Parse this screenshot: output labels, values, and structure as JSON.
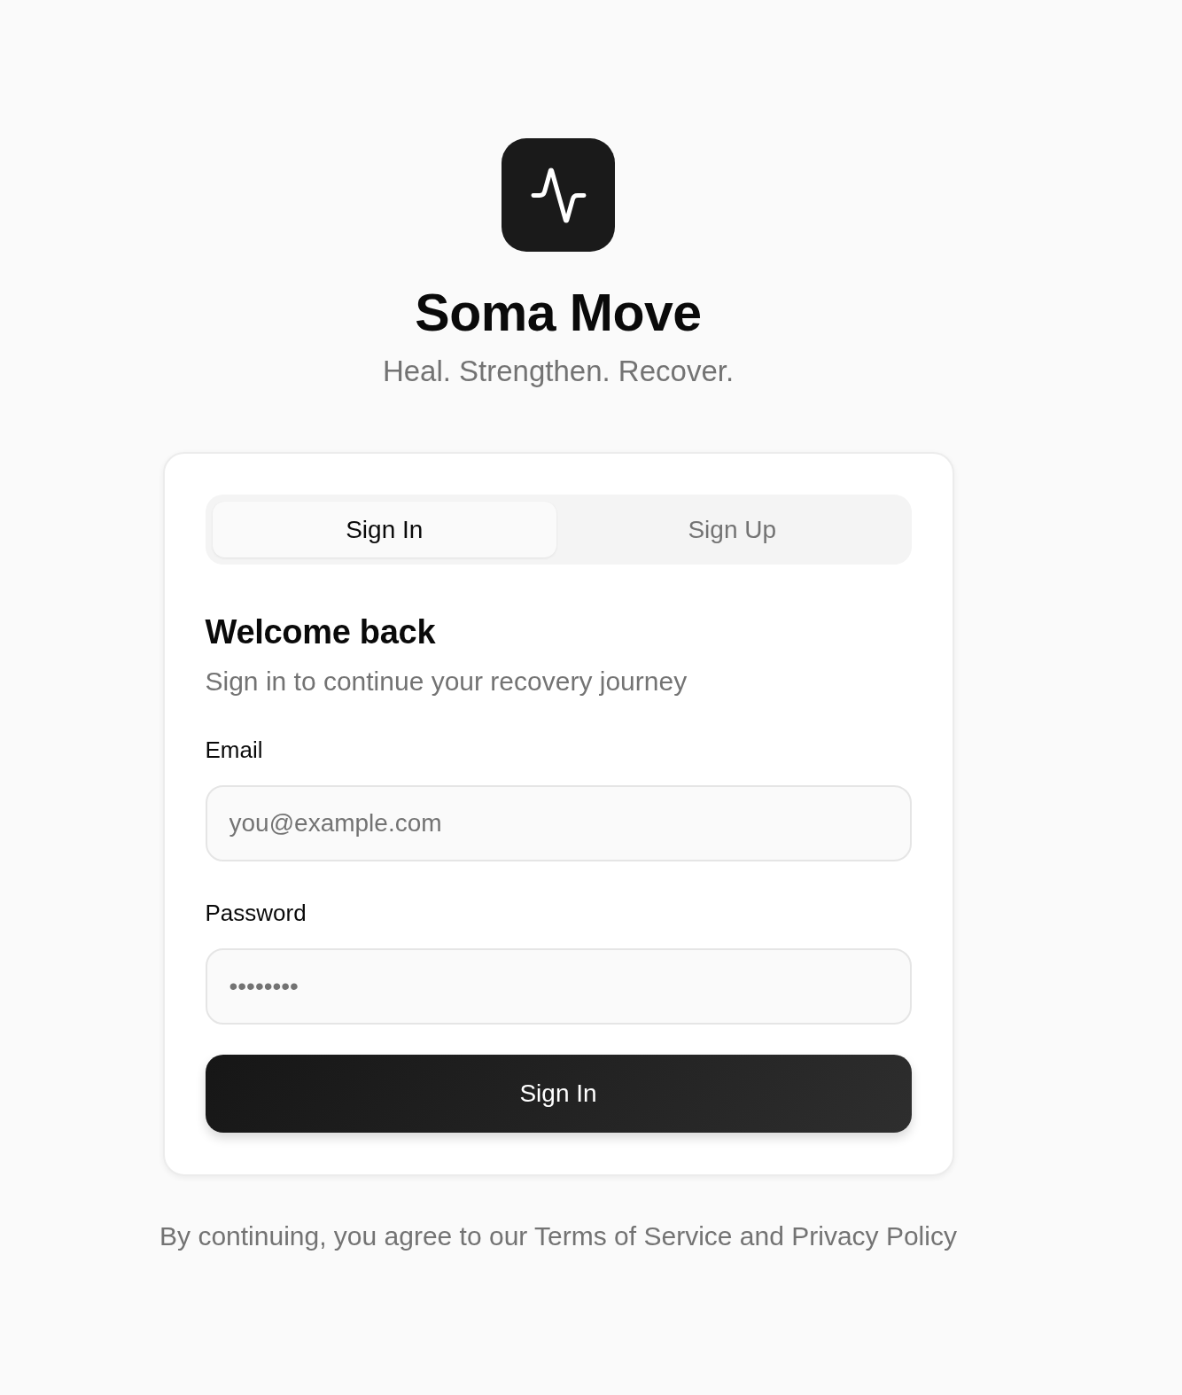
{
  "app": {
    "name": "Soma Move",
    "tagline": "Heal. Strengthen. Recover."
  },
  "tabs": [
    {
      "label": "Sign In",
      "selected": true
    },
    {
      "label": "Sign Up",
      "selected": false
    }
  ],
  "form": {
    "heading": "Welcome back",
    "subheading": "Sign in to continue your recovery journey",
    "fields": [
      {
        "label": "Email",
        "placeholder": "you@example.com"
      },
      {
        "label": "Password",
        "placeholder": "••••••••"
      }
    ],
    "submit": "Sign In"
  },
  "footer": "By continuing, you agree to our Terms of Service and Privacy Policy"
}
